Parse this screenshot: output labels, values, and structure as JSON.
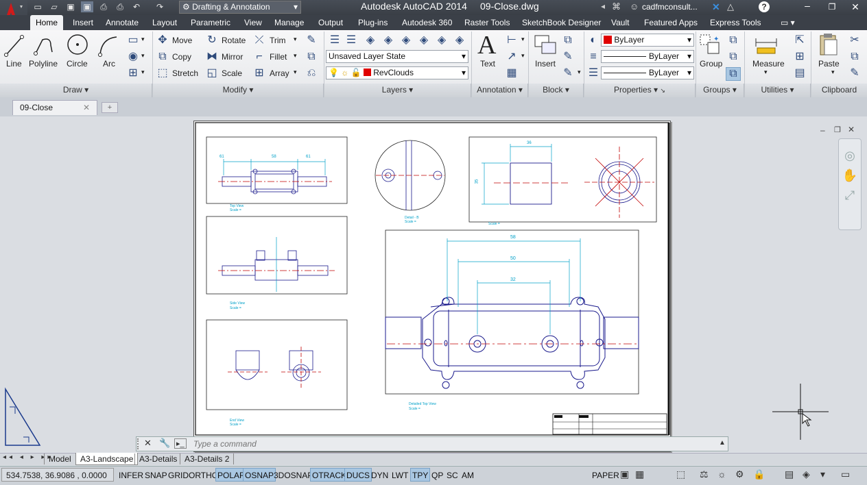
{
  "titlebar": {
    "workspace": "Drafting & Annotation",
    "app_title": "Autodesk AutoCAD 2014",
    "file_title": "09-Close.dwg",
    "user": "cadfmconsult..."
  },
  "tabs": [
    "Home",
    "Insert",
    "Annotate",
    "Layout",
    "Parametric",
    "View",
    "Manage",
    "Output",
    "Plug-ins",
    "Autodesk 360",
    "Raster Tools",
    "SketchBook Designer",
    "Vault",
    "Featured Apps",
    "Express Tools"
  ],
  "draw": {
    "line": "Line",
    "polyline": "Polyline",
    "circle": "Circle",
    "arc": "Arc",
    "panel": "Draw"
  },
  "modify": {
    "move": "Move",
    "rotate": "Rotate",
    "trim": "Trim",
    "copy": "Copy",
    "mirror": "Mirror",
    "fillet": "Fillet",
    "stretch": "Stretch",
    "scale": "Scale",
    "array": "Array",
    "panel": "Modify"
  },
  "layers": {
    "state": "Unsaved Layer State",
    "current": "RevClouds",
    "panel": "Layers"
  },
  "annotation": {
    "text": "Text",
    "panel": "Annotation"
  },
  "block": {
    "insert": "Insert",
    "panel": "Block"
  },
  "properties": {
    "color": "ByLayer",
    "linetype": "ByLayer",
    "lineweight": "ByLayer",
    "panel": "Properties"
  },
  "groups": {
    "group": "Group",
    "panel": "Groups"
  },
  "utilities": {
    "measure": "Measure",
    "panel": "Utilities"
  },
  "clipboard": {
    "paste": "Paste",
    "panel": "Clipboard"
  },
  "doc_tab": "09-Close",
  "drawing": {
    "top_view": "Top View",
    "side_view": "Side View",
    "end_view": "End View",
    "detail_b": "Detail - B",
    "detailed_top_view": "Detailed Top View",
    "scale": "Scale = ",
    "dim_61a": "61",
    "dim_58a": "58",
    "dim_61b": "61",
    "dim_36": "36",
    "dim_35": "35",
    "dim_58": "58",
    "dim_50": "50",
    "dim_32": "32"
  },
  "command": {
    "placeholder": "Type a command"
  },
  "layouts": [
    "Model",
    "A3-Landscape",
    "A3-Details",
    "A3-Details 2"
  ],
  "status": {
    "coords": "534.7538, 36.9086 , 0.0000",
    "toggles": [
      {
        "label": "INFER",
        "on": false
      },
      {
        "label": "SNAP",
        "on": false
      },
      {
        "label": "GRID",
        "on": false
      },
      {
        "label": "ORTHO",
        "on": false
      },
      {
        "label": "POLAR",
        "on": true
      },
      {
        "label": "OSNAP",
        "on": true
      },
      {
        "label": "3DOSNAP",
        "on": false
      },
      {
        "label": "OTRACK",
        "on": true
      },
      {
        "label": "DUCS",
        "on": true
      },
      {
        "label": "DYN",
        "on": false
      },
      {
        "label": "LWT",
        "on": false
      },
      {
        "label": "TPY",
        "on": true
      },
      {
        "label": "QP",
        "on": false
      },
      {
        "label": "SC",
        "on": false
      },
      {
        "label": "AM",
        "on": false
      }
    ],
    "space": "PAPER"
  },
  "colors": {
    "accent": "#1e5fa8",
    "dim": "#00a0c8",
    "geometry": "#1a1a8c",
    "center": "#c00000",
    "title_bg": "#3b4048"
  }
}
